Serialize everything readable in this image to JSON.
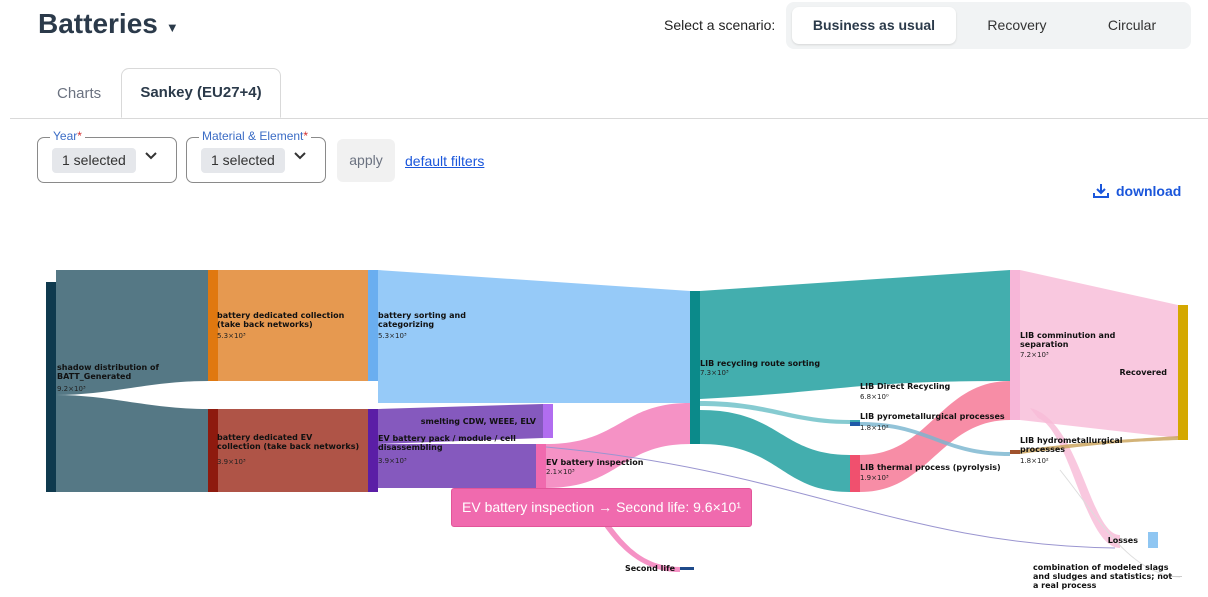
{
  "header": {
    "title": "Batteries",
    "scenario_label": "Select a scenario:",
    "scenarios": [
      {
        "label": "Business as usual",
        "active": true
      },
      {
        "label": "Recovery",
        "active": false
      },
      {
        "label": "Circular",
        "active": false
      }
    ]
  },
  "tabs": [
    {
      "label": "Charts",
      "active": false
    },
    {
      "label": "Sankey (EU27+4)",
      "active": true
    }
  ],
  "filters": {
    "year": {
      "label": "Year",
      "required_mark": "*",
      "value": "1 selected"
    },
    "material": {
      "label": "Material & Element",
      "required_mark": "*",
      "value": "1 selected"
    },
    "apply_label": "apply",
    "default_link": "default filters"
  },
  "download_label": "download",
  "sankey": {
    "nodes": [
      {
        "id": "shadow",
        "label": "shadow distribution of BATT_Generated",
        "value": "9.2×10³",
        "color": "#0f3a4e"
      },
      {
        "id": "collect",
        "label": "battery dedicated collection (take back networks)",
        "value": "5.3×10³",
        "color": "#e0780f"
      },
      {
        "id": "evcollect",
        "label": "battery dedicated EV collection (take back networks)",
        "value": "3.9×10³",
        "color": "#8e1a0e"
      },
      {
        "id": "sorting",
        "label": "battery sorting and categorizing",
        "value": "5.3×10³",
        "color": "#6aaef0"
      },
      {
        "id": "evpack",
        "label": "EV battery pack / module / cell disassembling",
        "value": "3.9×10³",
        "color": "#5b1ea6"
      },
      {
        "id": "smelting",
        "label": "smelting CDW, WEEE, ELV",
        "value": "",
        "color": "#b16df0"
      },
      {
        "id": "evinspect",
        "label": "EV battery inspection",
        "value": "2.1×10³",
        "color": "#f06aae"
      },
      {
        "id": "secondlife",
        "label": "Second life",
        "value": "",
        "color": "#1f4a8a"
      },
      {
        "id": "libsort",
        "label": "LIB recycling route sorting",
        "value": "7.3×10³",
        "color": "#0b8a8a"
      },
      {
        "id": "libdirect",
        "label": "LIB Direct Recycling",
        "value": "6.8×10⁰",
        "color": "#3aa6b0"
      },
      {
        "id": "libpyro",
        "label": "LIB pyrometallurgical processes",
        "value": "1.8×10²",
        "color": "#1f5aa8"
      },
      {
        "id": "libthermal",
        "label": "LIB thermal process (pyrolysis)",
        "value": "1.9×10³",
        "color": "#f0506e"
      },
      {
        "id": "libcomm",
        "label": "LIB comminution and separation",
        "value": "7.2×10³",
        "color": "#f7b6d8"
      },
      {
        "id": "libhydro",
        "label": "LIB hydrometallurgical processes",
        "value": "1.8×10²",
        "color": "#a0522d"
      },
      {
        "id": "recovered",
        "label": "Recovered",
        "value": "",
        "color": "#d4a800"
      },
      {
        "id": "losses",
        "label": "Losses",
        "value": "",
        "color": "#8fc6f2"
      },
      {
        "id": "slags",
        "label": "combination of modeled slags and sludges and statistics; not a real process",
        "value": "",
        "color": "#cccccc"
      }
    ],
    "tooltip": "EV battery inspection → Second life: 9.6×10¹"
  },
  "colors": {
    "accent": "#1a56db",
    "required": "#d32f2f",
    "tooltip_bg": "#f06aae"
  }
}
